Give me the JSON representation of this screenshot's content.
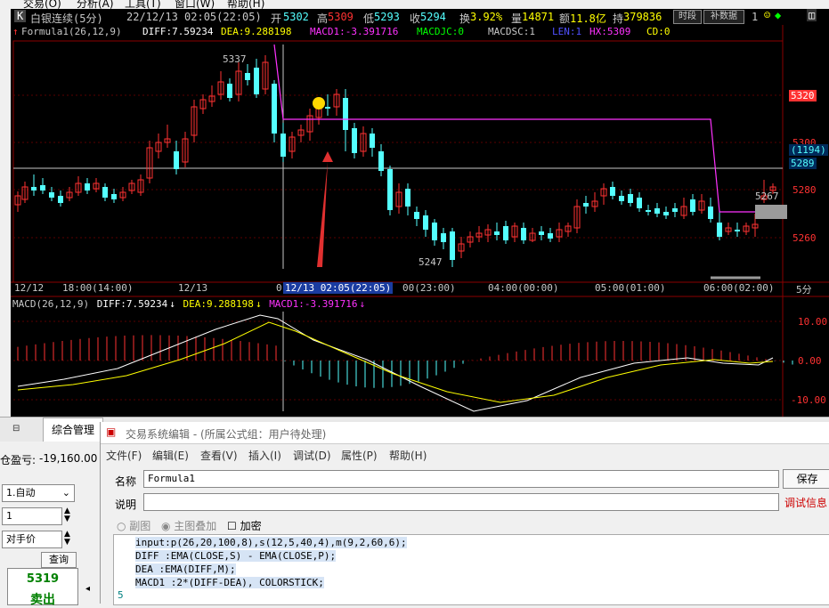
{
  "menu": [
    "交易(O)",
    "分析(A)",
    "工具(T)",
    "窗口(W)",
    "帮助(H)"
  ],
  "header": {
    "k_label": "K",
    "name": "白银连续(5分)",
    "datetime": "22/12/13 02:05(22:05)",
    "open_label": "开",
    "open": "5302",
    "high_label": "高",
    "high": "5309",
    "low_label": "低",
    "low": "5293",
    "close_label": "收",
    "close": "5294",
    "turnover_label": "换",
    "turnover": "3.92%",
    "volume_label": "量",
    "volume": "14871",
    "amount_label": "额",
    "amount": "11.8亿",
    "oi_label": "持",
    "oi": "379836",
    "btn_period": "时段",
    "btn_fill": "补数据",
    "oi_suffix": "1"
  },
  "formula_line": {
    "name": "Formula1(26,12,9)",
    "diff": "DIFF:7.59234",
    "dea": "DEA:9.288198",
    "macd1": "MACD1:-3.391716",
    "macdjc": "MACDJC:0",
    "macdsc": "MACDSC:1",
    "len": "LEN:1",
    "hx": "HX:5309",
    "cd": "CD:0"
  },
  "price_axis": {
    "ticks": [
      "5320",
      "5300",
      "5280",
      "5260"
    ],
    "current_price": "5289",
    "count_badge": "(1194)",
    "peak_label": "5337",
    "trough_label": "5247",
    "right_label": "5267"
  },
  "time_axis": [
    "12/12",
    "18:00(14:00)",
    "12/13",
    "0",
    "12/13 02:05(22:05)",
    "00(23:00)",
    "04:00(00:00)",
    "05:00(01:00)",
    "06:00(02:00)",
    "5分"
  ],
  "macd": {
    "title": "MACD(26,12,9)",
    "diff": "DIFF:7.59234",
    "dea": "DEA:9.288198",
    "macd1": "MACD1:-3.391716",
    "ticks": [
      "10.00",
      "0.00",
      "-10.00"
    ]
  },
  "colors": {
    "up": "#ff3232",
    "down": "#54ffff",
    "magenta": "#ff32ff",
    "dea": "#ffff00"
  },
  "tabs": {
    "composite": "综合管理"
  },
  "left_panel": {
    "pnl_label": "仓盈亏:",
    "pnl_value": "-19,160.00",
    "mode": "1.自动",
    "qty": "1",
    "price_type": "对手价",
    "query": "查询",
    "price": "5319",
    "buy_label": "卖出"
  },
  "editor": {
    "title": "交易系统编辑 - (所属公式组：用户待处理)",
    "menu": [
      "文件(F)",
      "编辑(E)",
      "查看(V)",
      "插入(I)",
      "调试(D)",
      "属性(P)",
      "帮助(H)"
    ],
    "name_label": "名称",
    "name_value": "Formula1",
    "desc_label": "说明",
    "desc_value": "",
    "save_button": "保存",
    "debug_info": "调试信息",
    "radio_sub": "副图",
    "radio_main": "主图叠加",
    "check_encrypt": "加密",
    "code": [
      "input:p(26,20,100,8),s(12,5,40,4),m(9,2,60,6);",
      "DIFF :EMA(CLOSE,S) - EMA(CLOSE,P);",
      "DEA  :EMA(DIFF,M);",
      "MACD1 :2*(DIFF-DEA), COLORSTICK;"
    ],
    "line_number": "5"
  }
}
